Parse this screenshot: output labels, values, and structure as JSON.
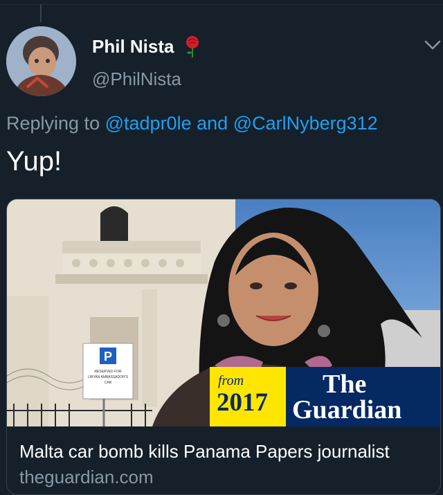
{
  "tweet": {
    "author": {
      "display_name": "Phil Nista",
      "handle": "@PhilNista",
      "emoji_icon": "rose-icon"
    },
    "reply": {
      "prefix": "Replying to",
      "mentions": [
        "@tadpr0le",
        "@CarlNyberg312"
      ],
      "conjunction": "and"
    },
    "text": "Yup!",
    "menu_icon": "chevron-down-icon"
  },
  "card": {
    "title": "Malta car bomb kills Panama Papers journalist",
    "domain": "theguardian.com",
    "image": {
      "sign": {
        "letter": "P",
        "line1": "RESERVED FOR",
        "line2": "LIBYAN AMBASSADOR'S",
        "line3": "CAR"
      },
      "badge": {
        "from": "from",
        "year": "2017",
        "brand_line1": "The",
        "brand_line2": "Guardian"
      }
    }
  },
  "colors": {
    "background": "#15202b",
    "mention": "#1da1f2",
    "secondary_text": "#8899a6",
    "guardian_blue": "#052962",
    "guardian_yellow": "#ffe500"
  }
}
